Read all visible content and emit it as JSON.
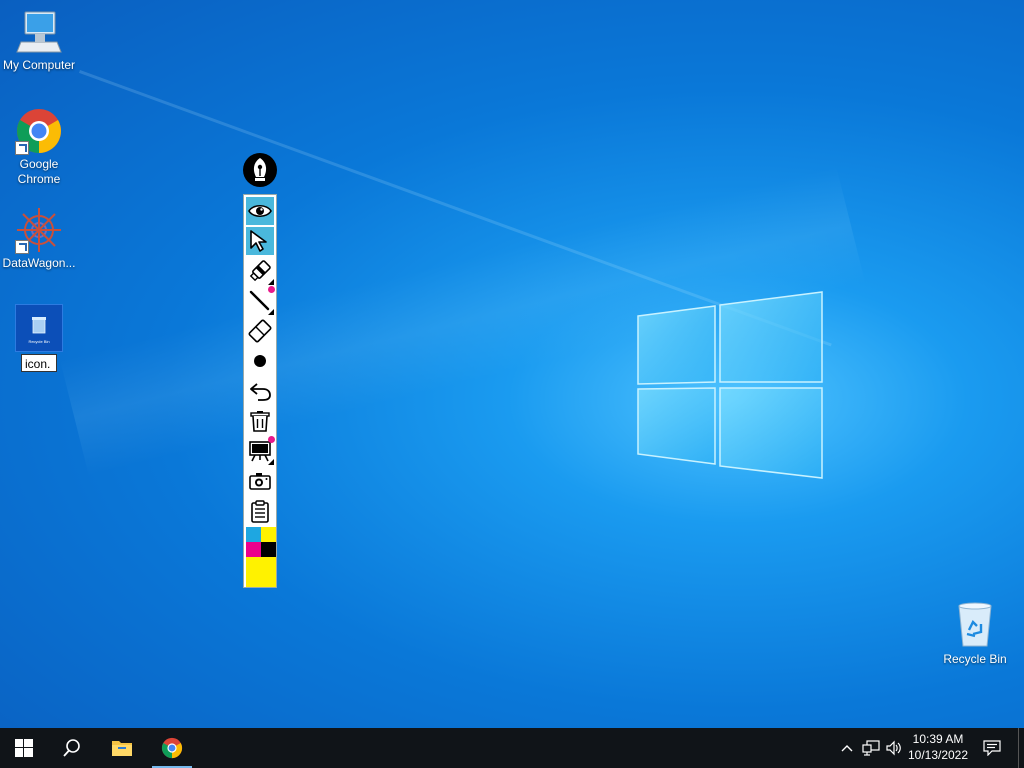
{
  "desktop_icons": {
    "my_computer": {
      "label": "My Computer",
      "icon": "computer-icon"
    },
    "google_chrome": {
      "label": "Google Chrome",
      "icon": "chrome-icon"
    },
    "datawagon": {
      "label": "DataWagon...",
      "icon": "datawagon-icon"
    },
    "recycle_bin_selected": {
      "icon": "recycle-bin-icon",
      "rename_value": "icon.",
      "thumb_text": "Recycle Bin"
    },
    "recycle_bin": {
      "label": "Recycle Bin",
      "icon": "recycle-bin-icon"
    }
  },
  "pen_toolbar": {
    "handle_icon": "fountain-pen-icon",
    "tools": [
      {
        "name": "eye-icon",
        "active": true
      },
      {
        "name": "cursor-arrow-icon",
        "active": true
      },
      {
        "name": "highlighter-icon",
        "active": false
      },
      {
        "name": "pen-line-icon",
        "active": false
      },
      {
        "name": "eraser-icon",
        "active": false
      },
      {
        "name": "dot-size-icon",
        "active": false
      },
      {
        "name": "undo-icon",
        "active": false
      },
      {
        "name": "trash-icon",
        "active": false
      },
      {
        "name": "whiteboard-icon",
        "active": false
      },
      {
        "name": "camera-icon",
        "active": false
      },
      {
        "name": "clipboard-icon",
        "active": false
      }
    ],
    "palette": [
      "#1ea7e1",
      "#fff200",
      "#ec008c",
      "#000000"
    ],
    "current_color": "#fff200"
  },
  "taskbar": {
    "start_icon": "windows-start-icon",
    "search_icon": "search-icon",
    "pinned": [
      "file-explorer-icon",
      "chrome-icon"
    ],
    "tray_icons": [
      "chevron-up-icon",
      "network-icon",
      "volume-icon",
      "notification-icon"
    ],
    "time": "10:39 AM",
    "date": "10/13/2022"
  }
}
